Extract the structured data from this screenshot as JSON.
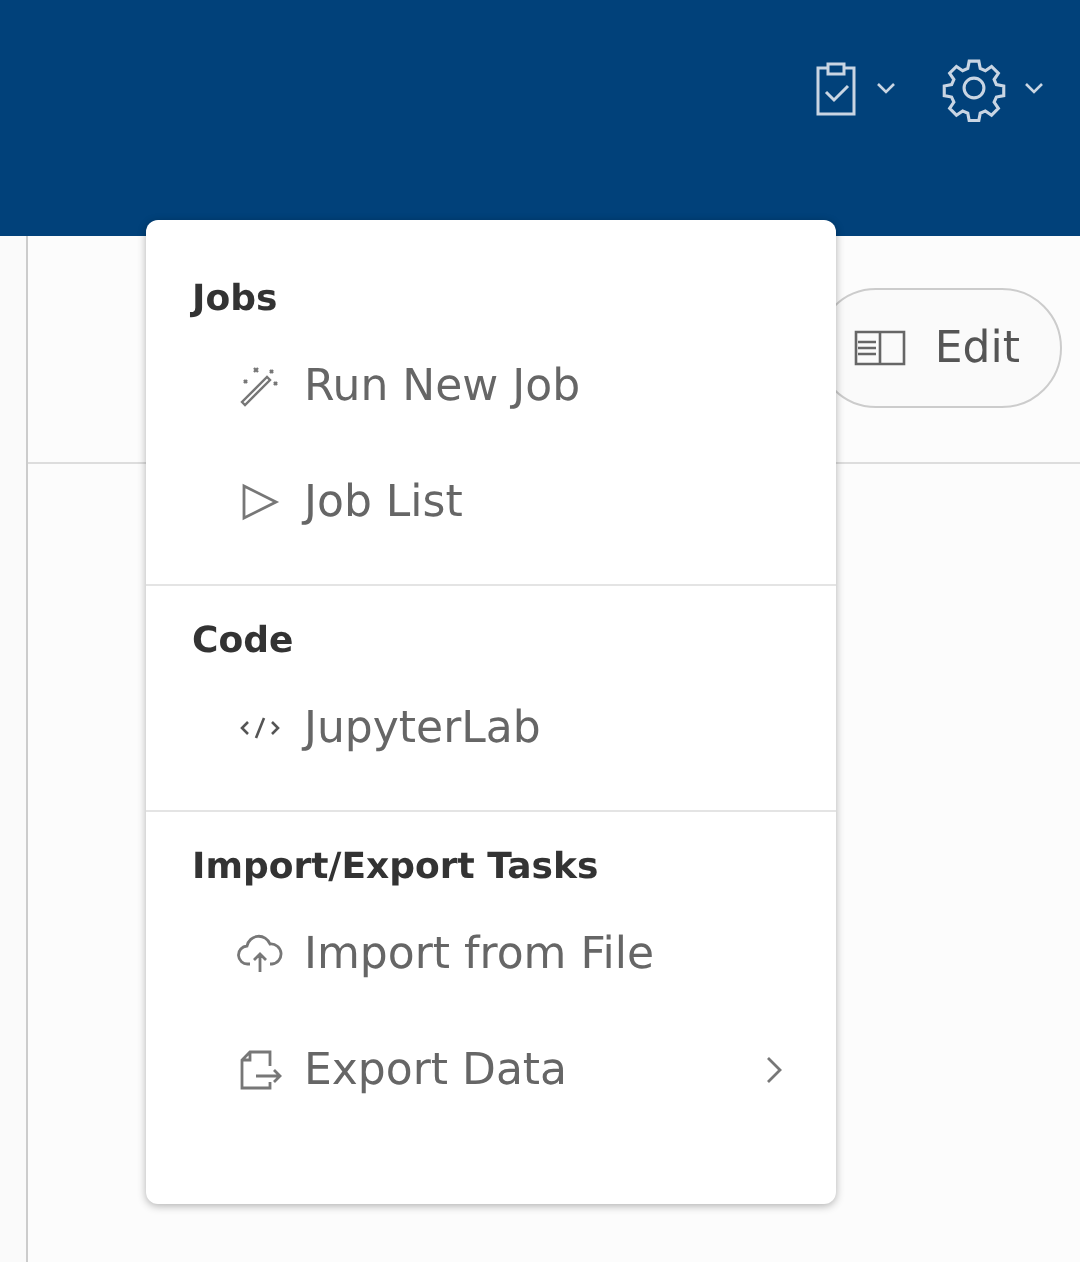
{
  "toolbar": {
    "edit_button": "Edit"
  },
  "menu": {
    "groups": [
      {
        "heading": "Jobs",
        "items": [
          {
            "label": "Run New Job",
            "has_submenu": false
          },
          {
            "label": "Job List",
            "has_submenu": false
          }
        ]
      },
      {
        "heading": "Code",
        "items": [
          {
            "label": "JupyterLab",
            "has_submenu": false
          }
        ]
      },
      {
        "heading": "Import/Export Tasks",
        "items": [
          {
            "label": "Import from File",
            "has_submenu": false
          },
          {
            "label": "Export Data",
            "has_submenu": true
          }
        ]
      }
    ]
  }
}
